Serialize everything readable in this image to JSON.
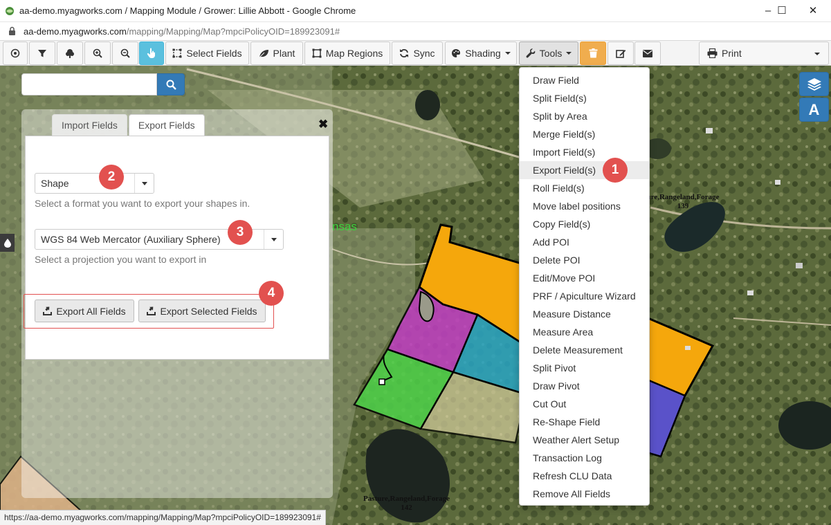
{
  "browser": {
    "window_title": "aa-demo.myagworks.com / Mapping Module / Grower: Lillie Abbott - Google Chrome",
    "url_host": "aa-demo.myagworks.com",
    "url_path": "/mapping/Mapping/Map?mpciPolicyOID=189923091#",
    "status_url": "https://aa-demo.myagworks.com/mapping/Mapping/Map?mpciPolicyOID=189923091#",
    "controls": {
      "minimize": "–",
      "maximize": "☐",
      "close": "✕"
    }
  },
  "toolbar": {
    "select_fields": "Select Fields",
    "plant": "Plant",
    "map_regions": "Map Regions",
    "sync": "Sync",
    "shading": "Shading",
    "tools": "Tools",
    "print": "Print"
  },
  "search": {
    "placeholder": "",
    "value": ""
  },
  "panel": {
    "tabs": [
      "Import Fields",
      "Export Fields"
    ],
    "active_tab": "Export Fields",
    "close_glyph": "✖",
    "format_value": "Shape",
    "format_help": "Select a format you want to export your shapes in.",
    "projection_value": "WGS 84 Web Mercator (Auxiliary Sphere)",
    "projection_help": "Select a projection you want to export in",
    "export_all": "Export All Fields",
    "export_selected": "Export Selected Fields"
  },
  "tools_menu": {
    "highlighted": "Export Field(s)",
    "items": [
      "Draw Field",
      "Split Field(s)",
      "Split by Area",
      "Merge Field(s)",
      "Import Field(s)",
      "Export Field(s)",
      "Roll Field(s)",
      "Move label positions",
      "Copy Field(s)",
      "Add POI",
      "Delete POI",
      "Edit/Move POI",
      "PRF / Apiculture Wizard",
      "Measure Distance",
      "Measure Area",
      "Delete Measurement",
      "Split Pivot",
      "Draw Pivot",
      "Cut Out",
      "Re-Shape Field",
      "Weather Alert Setup",
      "Transaction Log",
      "Refresh CLU Data",
      "Remove All Fields"
    ]
  },
  "callouts": [
    "1",
    "2",
    "3",
    "4"
  ],
  "map": {
    "label_top_right_line1": "ure,Rangeland,Forage",
    "label_top_right_line2": "139",
    "label_bottom_line1": "Pasture,Rangeland,Forage",
    "label_bottom_line2": "142",
    "green_text": "nsas",
    "layer_control_letter": "A"
  },
  "colors": {
    "accent_blue": "#337ab7",
    "active_tool": "#5bc0de",
    "delete_orange": "#f0ad4e",
    "callout_red": "#e2514f",
    "field_orange": "#f5a70c",
    "field_magenta": "#c23fc4",
    "field_teal": "#29a5c4",
    "field_green": "#4fd34a",
    "field_purple": "#5a52c9",
    "field_tan": "#d6cf9e"
  },
  "icons": [
    "locate-icon",
    "filter-icon",
    "tree-icon",
    "zoom-in-icon",
    "zoom-out-icon",
    "hand-pointer-icon",
    "select-square-icon",
    "leaf-icon",
    "map-regions-icon",
    "sync-icon",
    "palette-icon",
    "wrench-icon",
    "trash-icon",
    "edit-icon",
    "envelope-icon",
    "printer-icon",
    "search-icon",
    "layers-icon",
    "drop-icon",
    "export-icon",
    "lock-icon"
  ]
}
